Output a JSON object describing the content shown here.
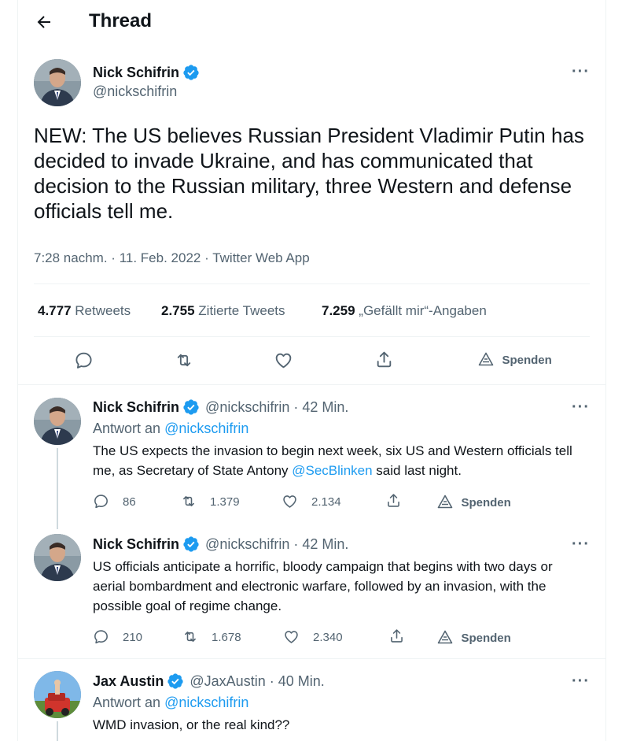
{
  "header": {
    "title": "Thread",
    "back_icon": "arrow-left-icon"
  },
  "main_tweet": {
    "name": "Nick Schifrin",
    "handle": "@nickschifrin",
    "text": "NEW: The US believes Russian President Vladimir Putin has decided to invade Ukraine, and has communicated that decision to the Russian military, three Western and defense officials tell me.",
    "time": "7:28 nachm.",
    "date": "11. Feb. 2022",
    "source": "Twitter Web App",
    "stats": [
      {
        "num": "4.777",
        "label": "Retweets"
      },
      {
        "num": "2.755",
        "label": "Zitierte Tweets"
      },
      {
        "num": "7.259",
        "label": "„Gefällt mir“-Angaben"
      }
    ],
    "spenden": "Spenden"
  },
  "replies": [
    {
      "name": "Nick Schifrin",
      "handle": "@nickschifrin",
      "time": "42 Min.",
      "reply_to_prefix": "Antwort an",
      "reply_to": "@nickschifrin",
      "text_pre": "The US expects the invasion to begin next week, six US and Western officials tell me, as Secretary of State Antony ",
      "mention": "@SecBlinken",
      "text_post": " said last night.",
      "replies": "86",
      "retweets": "1.379",
      "likes": "2.134",
      "spenden": "Spenden"
    },
    {
      "name": "Nick Schifrin",
      "handle": "@nickschifrin",
      "time": "42 Min.",
      "text": "US officials anticipate a horrific, bloody campaign that begins with two days or aerial bombardment and electronic warfare, followed by an invasion, with the possible goal of regime change.",
      "replies": "210",
      "retweets": "1.678",
      "likes": "2.340",
      "spenden": "Spenden"
    },
    {
      "name": "Jax Austin",
      "handle": "@JaxAustin",
      "time": "40 Min.",
      "reply_to_prefix": "Antwort an",
      "reply_to": "@nickschifrin",
      "text": "WMD invasion, or the real kind??"
    }
  ],
  "dot_sep": "·",
  "colors": {
    "accent": "#1d9bf0",
    "muted": "#536471",
    "text": "#0f1419"
  }
}
